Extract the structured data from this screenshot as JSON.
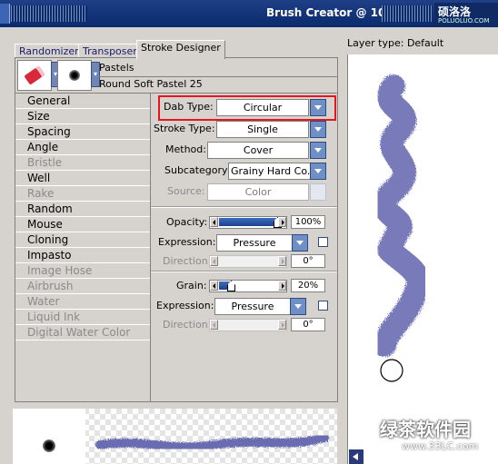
{
  "window": {
    "title": "Brush Creator @ 100%",
    "watermark_top_line1": "硕洛洛",
    "watermark_top_line2": "POLUOLUO.COM"
  },
  "tabs": [
    "Randomizer",
    "Transposer",
    "Stroke Designer"
  ],
  "active_tab": "Stroke Designer",
  "layer_type": "Layer type: Default",
  "brush": {
    "category": "Pastels",
    "variant": "Round Soft Pastel 25"
  },
  "categories": [
    {
      "label": "General",
      "enabled": true,
      "selected": true
    },
    {
      "label": "Size",
      "enabled": true
    },
    {
      "label": "Spacing",
      "enabled": true
    },
    {
      "label": "Angle",
      "enabled": true
    },
    {
      "label": "Bristle",
      "enabled": false
    },
    {
      "label": "Well",
      "enabled": true
    },
    {
      "label": "Rake",
      "enabled": false
    },
    {
      "label": "Random",
      "enabled": true
    },
    {
      "label": "Mouse",
      "enabled": true
    },
    {
      "label": "Cloning",
      "enabled": true
    },
    {
      "label": "Impasto",
      "enabled": true
    },
    {
      "label": "Image Hose",
      "enabled": false
    },
    {
      "label": "Airbrush",
      "enabled": false
    },
    {
      "label": "Water",
      "enabled": false
    },
    {
      "label": "Liquid Ink",
      "enabled": false
    },
    {
      "label": "Digital Water Color",
      "enabled": false
    }
  ],
  "controls": {
    "dab_type": {
      "label": "Dab Type:",
      "value": "Circular"
    },
    "stroke_type": {
      "label": "Stroke Type:",
      "value": "Single"
    },
    "method": {
      "label": "Method:",
      "value": "Cover"
    },
    "subcategory": {
      "label": "Subcategory:",
      "value": "Grainy Hard Co..."
    },
    "source": {
      "label": "Source:",
      "value": "Color"
    },
    "opacity": {
      "label": "Opacity:",
      "value": "100%",
      "fraction": 1.0
    },
    "opacity_expression": {
      "label": "Expression:",
      "value": "Pressure"
    },
    "opacity_direction": {
      "label": "Direction:",
      "value": "0°"
    },
    "grain": {
      "label": "Grain:",
      "value": "20%",
      "fraction": 0.2
    },
    "grain_expression": {
      "label": "Expression:",
      "value": "Pressure"
    },
    "grain_direction": {
      "label": "Direction:",
      "value": "0°"
    }
  },
  "watermark_bottom": {
    "line1": "绿茶软件园",
    "line2": "www.33LC.com"
  },
  "colors": {
    "stroke": "#6a6cb2",
    "highlight_border": "#e8141e",
    "title_bar": "#0a2a6d"
  }
}
